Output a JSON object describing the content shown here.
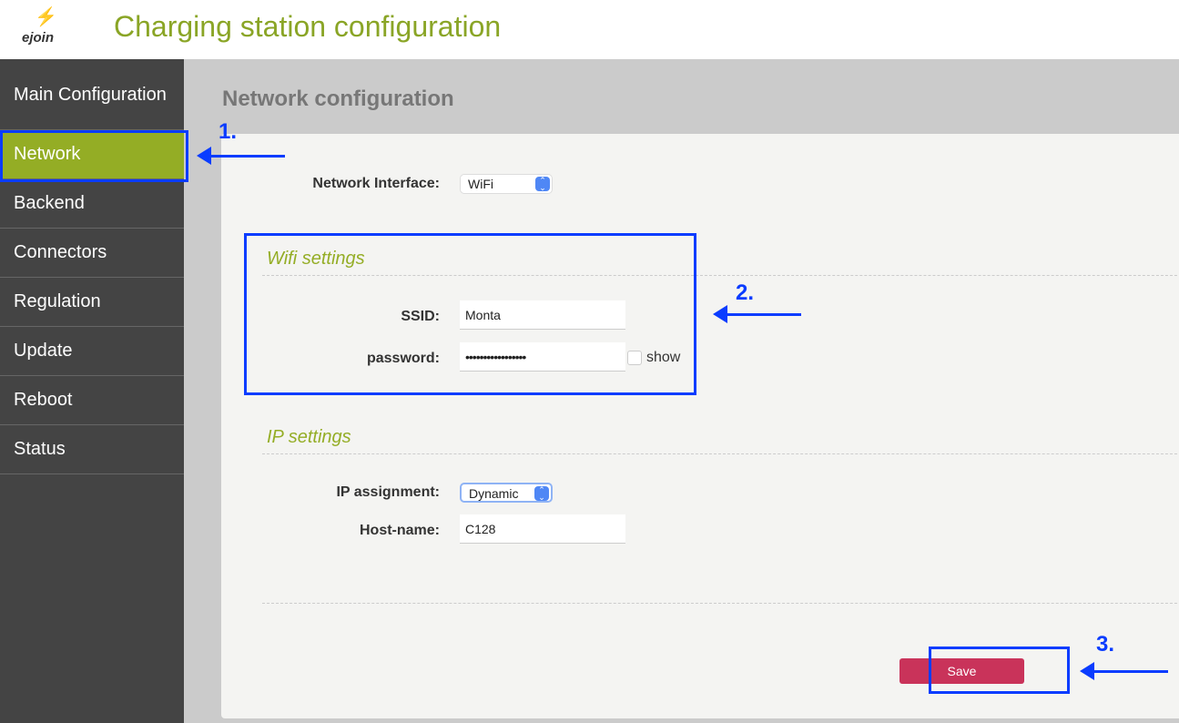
{
  "header": {
    "logo_text": "ejoin",
    "title": "Charging station configuration"
  },
  "sidebar": {
    "items": [
      {
        "label": "Main Configuration"
      },
      {
        "label": "Network"
      },
      {
        "label": "Backend"
      },
      {
        "label": "Connectors"
      },
      {
        "label": "Regulation"
      },
      {
        "label": "Update"
      },
      {
        "label": "Reboot"
      },
      {
        "label": "Status"
      }
    ],
    "active": "Network"
  },
  "main": {
    "title": "Network configuration",
    "network_interface": {
      "label": "Network Interface:",
      "value": "WiFi"
    },
    "wifi": {
      "title": "Wifi settings",
      "ssid_label": "SSID:",
      "ssid": "Monta",
      "password_label": "password:",
      "password": "•••••••••••••••••",
      "show_label": "show",
      "show_checked": false
    },
    "ip": {
      "title": "IP settings",
      "assignment_label": "IP assignment:",
      "assignment": "Dynamic",
      "hostname_label": "Host-name:",
      "hostname": "C128"
    },
    "save_label": "Save"
  },
  "annotations": {
    "step1": "1.",
    "step2": "2.",
    "step3": "3.",
    "color": "#0a3cff"
  },
  "colors": {
    "accent": "#94ad25",
    "save": "#c9335a",
    "sidebar": "#444444"
  }
}
